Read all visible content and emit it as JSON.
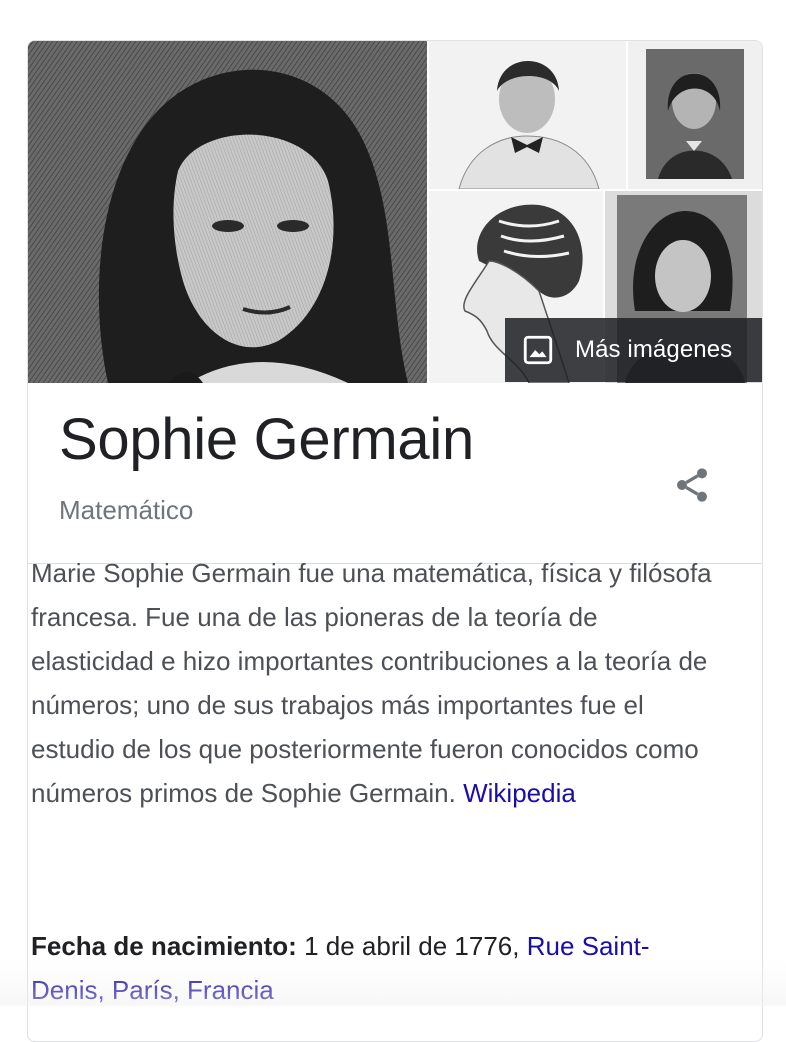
{
  "images": {
    "main": "portrait-engraving-main",
    "thumbs": [
      "portrait-white-dress",
      "portrait-small-engraving",
      "profile-braided-hair",
      "portrait-hair-ribbon"
    ],
    "more_images_label": "Más imágenes",
    "more_images_icon": "image-icon"
  },
  "entity": {
    "name": "Sophie Germain",
    "type": "Matemático",
    "share_icon": "share-icon"
  },
  "description": {
    "text": "Marie Sophie Germain  fue una matemática, física y filósofa francesa. Fue una de las pioneras de la teoría de elasticidad e hizo importantes contribuciones a la teoría de números; uno de sus trabajos más importantes fue el estudio de los que posteriormente fueron conocidos como números primos de Sophie Germain.",
    "source_link": "Wikipedia"
  },
  "facts": [
    {
      "label": "Fecha de nacimiento:",
      "value": "1 de abril de 1776, ",
      "link": "Rue Saint-Denis, París, Francia"
    }
  ],
  "colors": {
    "link": "#1a0dab",
    "title": "#202124",
    "body_text": "#4d5156",
    "subtitle": "#70757a",
    "border": "#dfe1e5"
  }
}
